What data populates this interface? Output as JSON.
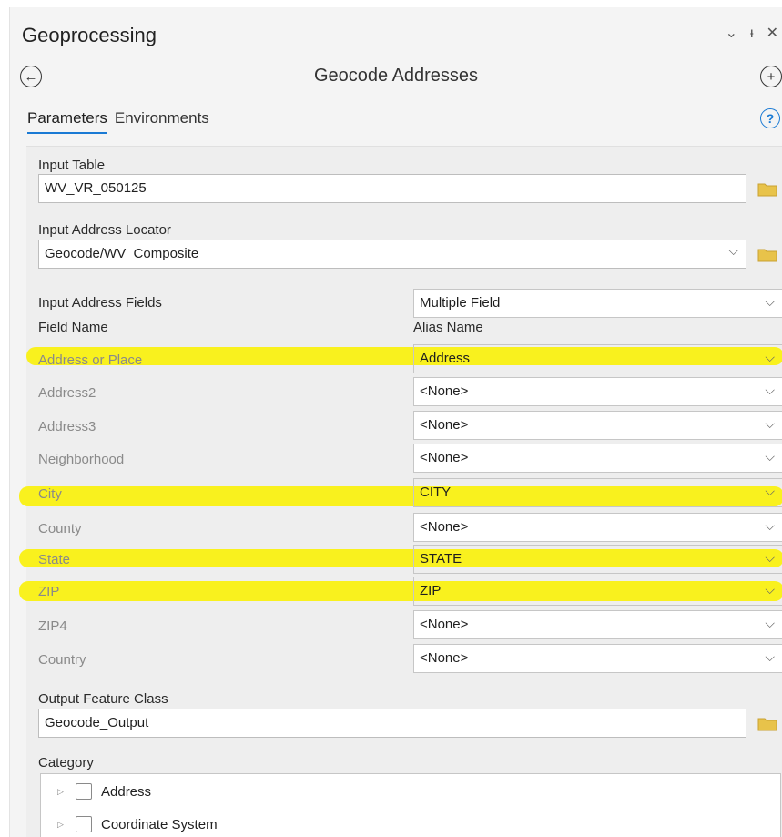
{
  "pane": {
    "title": "Geoprocessing",
    "controls": {
      "menu": "⌄",
      "pin": "ᵻ",
      "close": "✕"
    }
  },
  "tool": {
    "title": "Geocode Addresses",
    "back_icon": "arrow-left-circle-icon",
    "add_icon": "plus-circle-icon"
  },
  "tabs": [
    {
      "label": "Parameters",
      "active": true
    },
    {
      "label": "Environments",
      "active": false
    }
  ],
  "help_glyph": "?",
  "params": {
    "input_table": {
      "label": "Input Table",
      "value": "WV_VR_050125"
    },
    "locator": {
      "label": "Input Address Locator",
      "value": "Geocode/WV_Composite"
    },
    "address_fields": {
      "label": "Input Address Fields",
      "value": "Multiple Field"
    },
    "field_name_header": "Field Name",
    "alias_name_header": "Alias Name",
    "rows": [
      {
        "field": "Address or Place",
        "alias": "Address",
        "highlighted": true
      },
      {
        "field": "Address2",
        "alias": "<None>",
        "highlighted": false
      },
      {
        "field": "Address3",
        "alias": "<None>",
        "highlighted": false
      },
      {
        "field": "Neighborhood",
        "alias": "<None>",
        "highlighted": false
      },
      {
        "field": "City",
        "alias": "CITY",
        "highlighted": true
      },
      {
        "field": "County",
        "alias": "<None>",
        "highlighted": false
      },
      {
        "field": "State",
        "alias": "STATE",
        "highlighted": true
      },
      {
        "field": "ZIP",
        "alias": "ZIP",
        "highlighted": true
      },
      {
        "field": "ZIP4",
        "alias": "<None>",
        "highlighted": false
      },
      {
        "field": "Country",
        "alias": "<None>",
        "highlighted": false
      }
    ],
    "output": {
      "label": "Output Feature Class",
      "value": "Geocode_Output"
    },
    "category": {
      "label": "Category",
      "items": [
        {
          "label": "Address"
        },
        {
          "label": "Coordinate System"
        }
      ]
    }
  },
  "colors": {
    "accent": "#1a7ad4",
    "highlight": "#f9f107",
    "folder": "#e8c34a"
  }
}
